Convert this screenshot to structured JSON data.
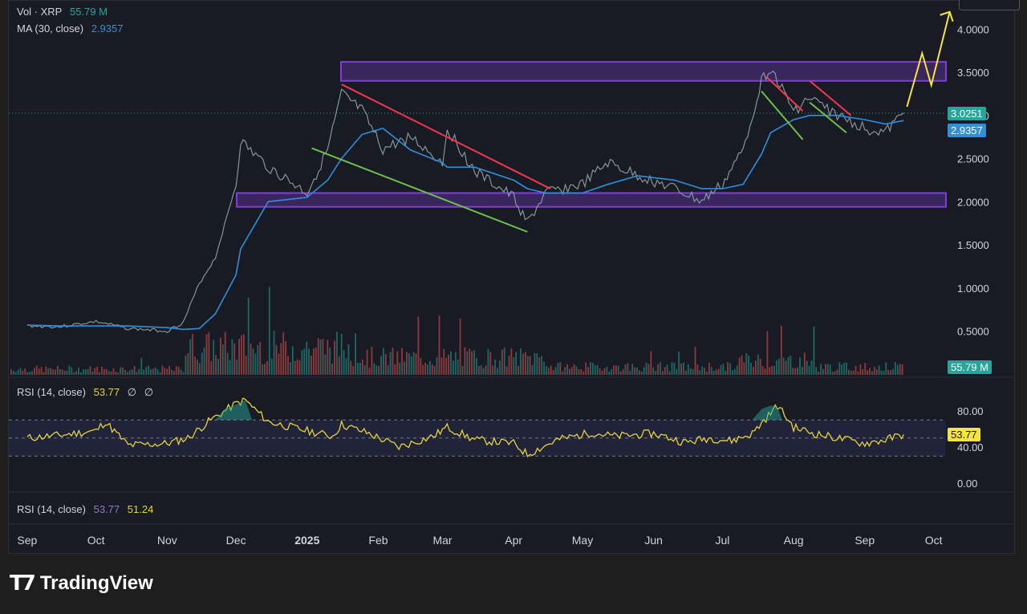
{
  "legend": {
    "vol_label": "Vol · XRP",
    "vol_value": "55.79 M",
    "ma_label": "MA (30, close)",
    "ma_value": "2.9357",
    "rsi_label": "RSI (14, close)",
    "rsi_value": "53.77",
    "rsi_extra1": "∅",
    "rsi_extra2": "∅",
    "rsi2_label": "RSI (14, close)",
    "rsi2_value1": "53.77",
    "rsi2_value2": "51.24"
  },
  "price_tags": {
    "price": "3.0251",
    "ma": "2.9357",
    "volume": "55.79 M",
    "rsi": "53.77"
  },
  "colors": {
    "background": "#181b24",
    "ma": "#2f8fdb",
    "volume_up": "#26a69a",
    "volume_down": "#ef5350",
    "rsi": "#e6d33c",
    "zone": "#7e3fd6",
    "trend_red": "#f2384c",
    "trend_green": "#6ec04b",
    "arrow": "#f7e53b"
  },
  "brand": "TradingView",
  "chart_data": [
    {
      "type": "line",
      "name": "XRP price with MA (30, close)",
      "y_axis_labels": [
        "4.0000",
        "3.5000",
        "3.0000",
        "2.5000",
        "2.0000",
        "1.5000",
        "1.0000",
        "0.5000"
      ],
      "x_axis_labels": [
        "Sep",
        "Oct",
        "Nov",
        "Dec",
        "2025",
        "Feb",
        "Mar",
        "Apr",
        "May",
        "Jun",
        "Jul",
        "Aug",
        "Sep",
        "Oct"
      ],
      "ylim": [
        0.5,
        4.0
      ],
      "dates": [
        "2024-09-01",
        "2024-09-15",
        "2024-10-01",
        "2024-10-15",
        "2024-11-01",
        "2024-11-08",
        "2024-11-15",
        "2024-11-22",
        "2024-12-01",
        "2024-12-03",
        "2024-12-15",
        "2025-01-01",
        "2025-01-10",
        "2025-01-16",
        "2025-01-25",
        "2025-02-03",
        "2025-02-15",
        "2025-03-01",
        "2025-03-03",
        "2025-03-15",
        "2025-04-01",
        "2025-04-07",
        "2025-04-15",
        "2025-05-01",
        "2025-05-12",
        "2025-05-25",
        "2025-06-10",
        "2025-06-22",
        "2025-07-01",
        "2025-07-10",
        "2025-07-18",
        "2025-07-22",
        "2025-08-01",
        "2025-08-08",
        "2025-08-20",
        "2025-09-01",
        "2025-09-10",
        "2025-09-18"
      ],
      "close": [
        0.56,
        0.55,
        0.61,
        0.53,
        0.5,
        0.6,
        1.05,
        1.35,
        2.2,
        2.7,
        2.4,
        2.1,
        2.6,
        3.25,
        3.05,
        2.6,
        2.75,
        2.45,
        2.85,
        2.35,
        2.05,
        1.75,
        2.1,
        2.2,
        2.45,
        2.3,
        2.15,
        2.0,
        2.2,
        2.6,
        3.4,
        3.55,
        3.05,
        3.2,
        3.0,
        2.85,
        2.8,
        3.03
      ],
      "ma30": [
        0.57,
        0.56,
        0.56,
        0.56,
        0.54,
        0.52,
        0.53,
        0.7,
        1.15,
        1.45,
        2.0,
        2.05,
        2.25,
        2.5,
        2.78,
        2.85,
        2.6,
        2.45,
        2.4,
        2.4,
        2.25,
        2.15,
        2.1,
        2.1,
        2.2,
        2.3,
        2.25,
        2.15,
        2.15,
        2.2,
        2.55,
        2.8,
        2.95,
        3.0,
        3.0,
        2.95,
        2.9,
        2.94
      ],
      "resistance_zone": [
        3.4,
        3.62
      ],
      "support_zone": [
        1.94,
        2.1
      ],
      "projection_target": "above 4.0000"
    },
    {
      "type": "bar",
      "name": "Volume",
      "last_value": "55.79 M"
    },
    {
      "type": "line",
      "name": "RSI (14, close)",
      "y_axis_labels": [
        "80.00",
        "40.00",
        "0.00"
      ],
      "ylim": [
        0,
        100
      ],
      "bands": [
        30,
        50,
        70
      ],
      "dates": [
        "2024-09-01",
        "2024-09-15",
        "2024-10-01",
        "2024-10-05",
        "2024-10-15",
        "2024-11-01",
        "2024-11-10",
        "2024-11-20",
        "2024-12-01",
        "2024-12-05",
        "2024-12-15",
        "2025-01-01",
        "2025-01-12",
        "2025-01-16",
        "2025-01-28",
        "2025-02-10",
        "2025-02-25",
        "2025-03-03",
        "2025-03-15",
        "2025-04-01",
        "2025-04-07",
        "2025-04-20",
        "2025-05-05",
        "2025-05-15",
        "2025-06-01",
        "2025-06-15",
        "2025-06-25",
        "2025-07-05",
        "2025-07-14",
        "2025-07-20",
        "2025-07-25",
        "2025-08-01",
        "2025-08-10",
        "2025-08-20",
        "2025-09-01",
        "2025-09-10",
        "2025-09-18"
      ],
      "values": [
        50,
        53,
        58,
        68,
        42,
        44,
        50,
        70,
        88,
        92,
        68,
        58,
        52,
        65,
        55,
        40,
        52,
        62,
        48,
        44,
        32,
        48,
        56,
        52,
        55,
        45,
        50,
        47,
        55,
        72,
        86,
        62,
        55,
        50,
        44,
        48,
        54
      ]
    }
  ]
}
